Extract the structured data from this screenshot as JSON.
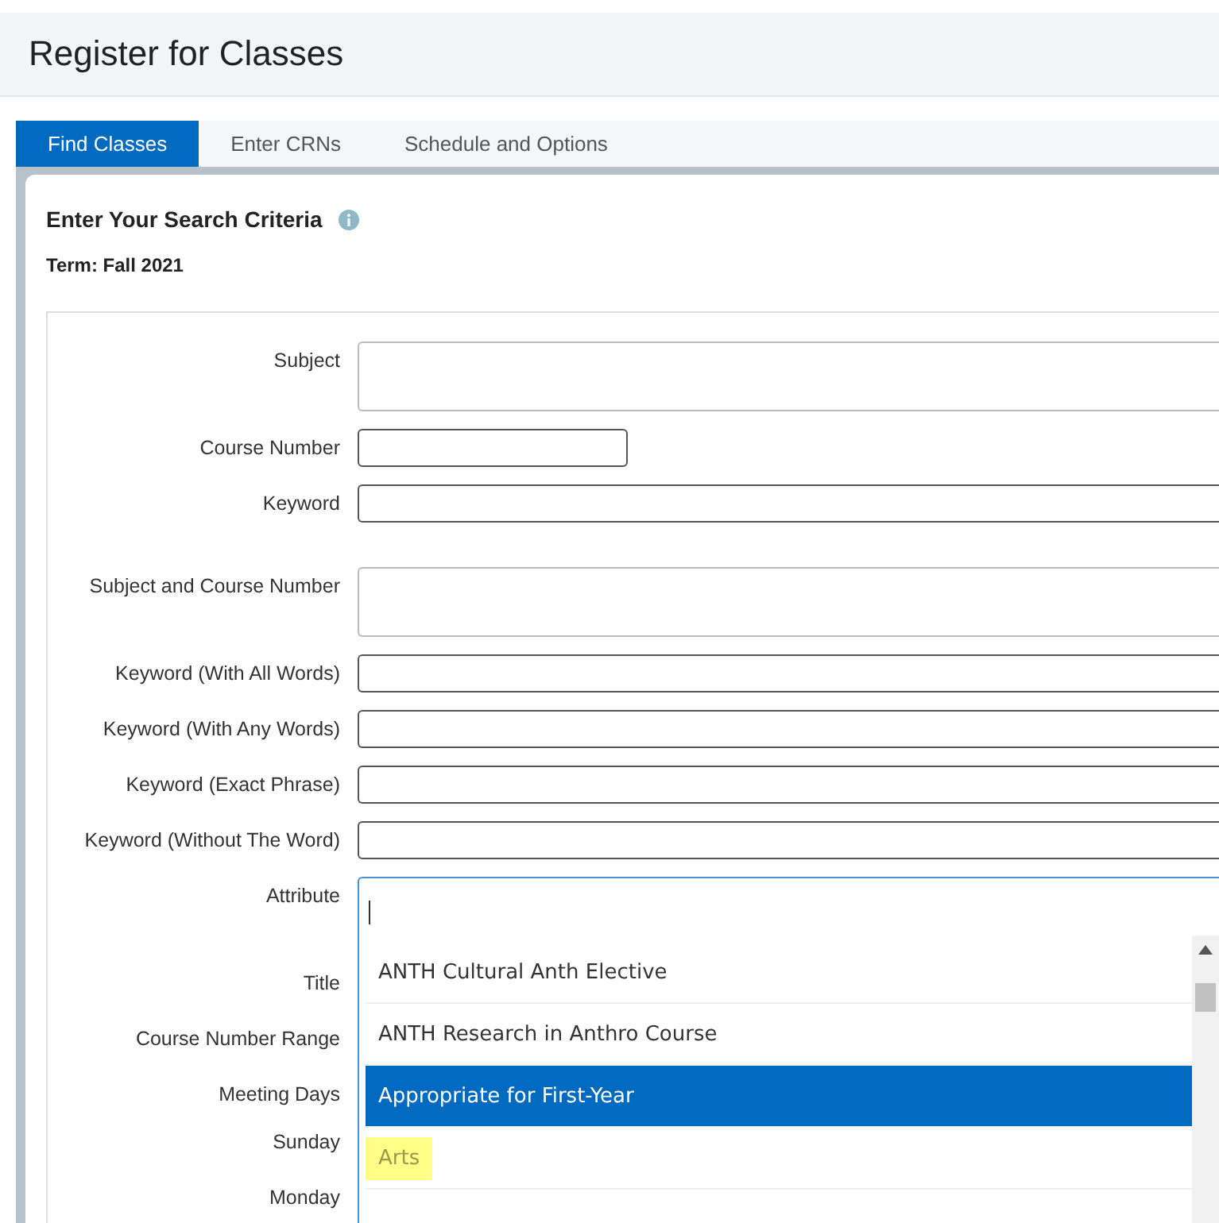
{
  "page_title": "Register for Classes",
  "tabs": [
    {
      "label": "Find Classes",
      "selected": true
    },
    {
      "label": "Enter CRNs",
      "selected": false
    },
    {
      "label": "Schedule and Options",
      "selected": false
    }
  ],
  "heading": "Enter Your Search Criteria",
  "term": "Term: Fall 2021",
  "fields": [
    {
      "label": "Subject",
      "kind": "tall"
    },
    {
      "label": "Course Number",
      "kind": "short"
    },
    {
      "label": "Keyword",
      "kind": "line"
    },
    {
      "label": "Subject and Course Number",
      "kind": "tall"
    },
    {
      "label": "Keyword (With All Words)",
      "kind": "line"
    },
    {
      "label": "Keyword (With Any Words)",
      "kind": "line"
    },
    {
      "label": "Keyword (Exact Phrase)",
      "kind": "line"
    },
    {
      "label": "Keyword (Without The Word)",
      "kind": "line"
    },
    {
      "label": "Attribute",
      "kind": "combo"
    },
    {
      "label": "Title",
      "kind": "hidden"
    },
    {
      "label": "Course Number Range",
      "kind": "hidden"
    },
    {
      "label": "Meeting Days",
      "kind": "label"
    },
    {
      "label": "Sunday",
      "kind": "hidden"
    },
    {
      "label": "Monday",
      "kind": "hidden"
    }
  ],
  "dropdown": {
    "options": [
      {
        "label": "ANTH Cultural Anth Elective",
        "selected": false,
        "highlighted": false
      },
      {
        "label": "ANTH Research in Anthro Course",
        "selected": false,
        "highlighted": false
      },
      {
        "label": "Appropriate for First-Year",
        "selected": true,
        "highlighted": false
      },
      {
        "label": "Arts",
        "selected": false,
        "highlighted": true
      }
    ]
  }
}
